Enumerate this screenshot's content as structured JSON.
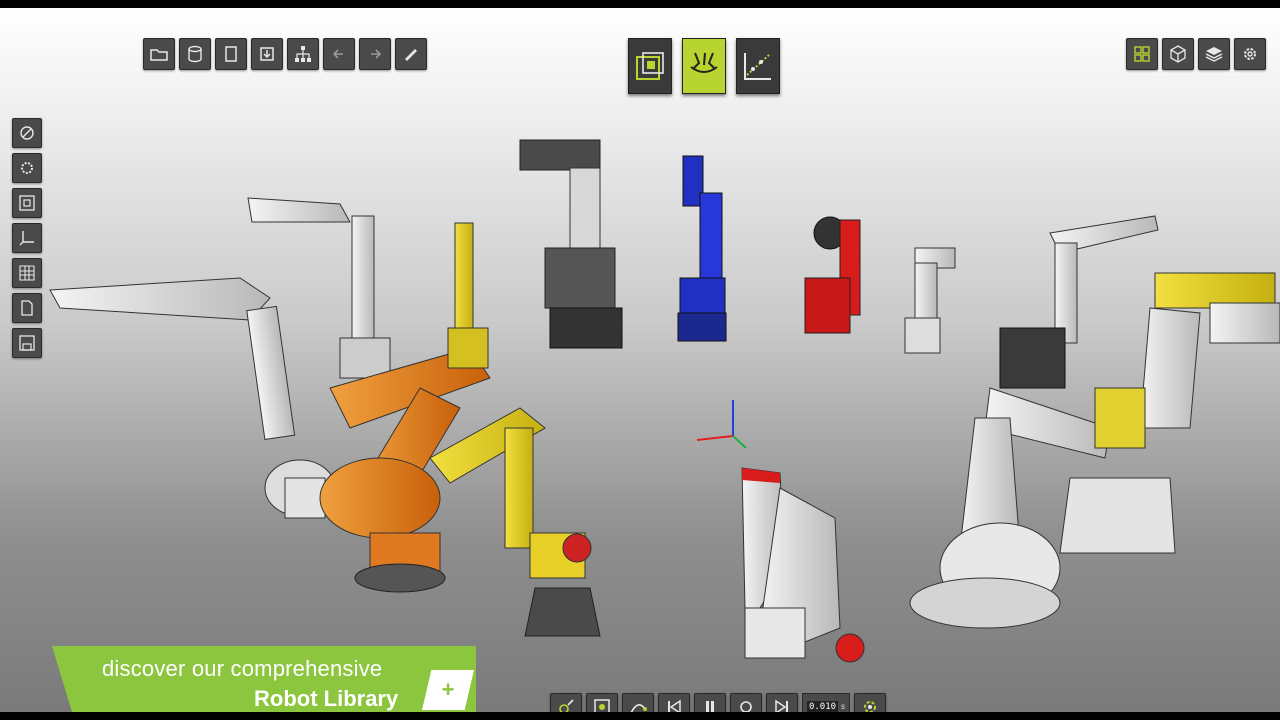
{
  "colors": {
    "accent": "#b8d430",
    "banner_green": "#8cc63f",
    "toolbar_button": "#4a4a4a",
    "icon_light": "#e8e8e8"
  },
  "top_left_toolbar": [
    {
      "name": "open-folder-icon"
    },
    {
      "name": "database-icon"
    },
    {
      "name": "document-icon"
    },
    {
      "name": "import-icon"
    },
    {
      "name": "hierarchy-icon"
    },
    {
      "name": "arrow-left-icon"
    },
    {
      "name": "arrow-right-icon"
    },
    {
      "name": "pencil-icon"
    }
  ],
  "mode_buttons": [
    {
      "name": "layout-mode-icon",
      "active": false
    },
    {
      "name": "robot-cell-mode-icon",
      "active": true
    },
    {
      "name": "graph-mode-icon",
      "active": false
    }
  ],
  "top_right_toolbar": [
    {
      "name": "grid-view-icon"
    },
    {
      "name": "cube-icon"
    },
    {
      "name": "layers-icon"
    },
    {
      "name": "gear-icon"
    }
  ],
  "left_toolbar": [
    {
      "name": "target-icon"
    },
    {
      "name": "settings-gear-icon"
    },
    {
      "name": "frame-icon"
    },
    {
      "name": "axes-icon"
    },
    {
      "name": "grid-icon"
    },
    {
      "name": "file-icon"
    },
    {
      "name": "save-icon"
    }
  ],
  "banner": {
    "line1": "discover our comprehensive",
    "line2": "Robot Library",
    "plus": "+"
  },
  "playback": {
    "time_value": "0.010",
    "time_unit": "s"
  }
}
